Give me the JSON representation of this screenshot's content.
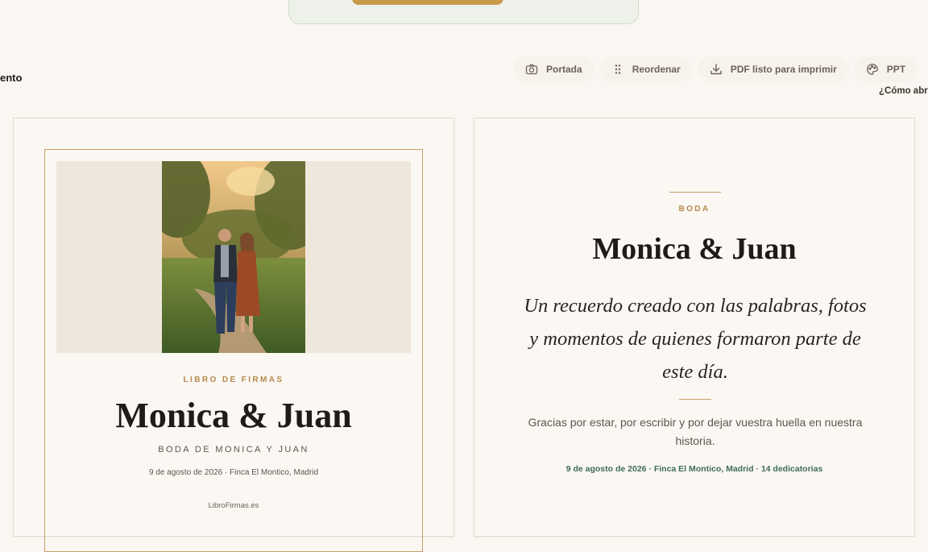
{
  "header": {
    "left_label": "ento",
    "toolbar": [
      {
        "label": "Portada",
        "icon": "camera-icon"
      },
      {
        "label": "Reordenar",
        "icon": "drag-handle-icon"
      },
      {
        "label": "PDF listo para imprimir",
        "icon": "download-icon"
      },
      {
        "label": "PPT",
        "icon": "palette-icon"
      }
    ],
    "help_link": "¿Cómo abr"
  },
  "cover": {
    "overline": "LIBRO DE FIRMAS",
    "title": "Monica & Juan",
    "subtitle": "BODA DE MONICA Y JUAN",
    "date_place": "9 de agosto de 2026 · Finca El Montico, Madrid",
    "site": "LibroFirmas.es"
  },
  "intro": {
    "overline": "BODA",
    "title": "Monica & Juan",
    "quote": "Un recuerdo creado con las palabras, fotos y momentos de quienes formaron parte de este día.",
    "thanks": "Gracias por estar, por escribir y por dejar vuestra huella en nuestra historia.",
    "meta": "9 de agosto de 2026 · Finca El Montico, Madrid · 14 dedicatorias"
  },
  "colors": {
    "background": "#faf6f1",
    "accent_gold": "#c9a06a",
    "accent_green": "#3f6b5e"
  }
}
